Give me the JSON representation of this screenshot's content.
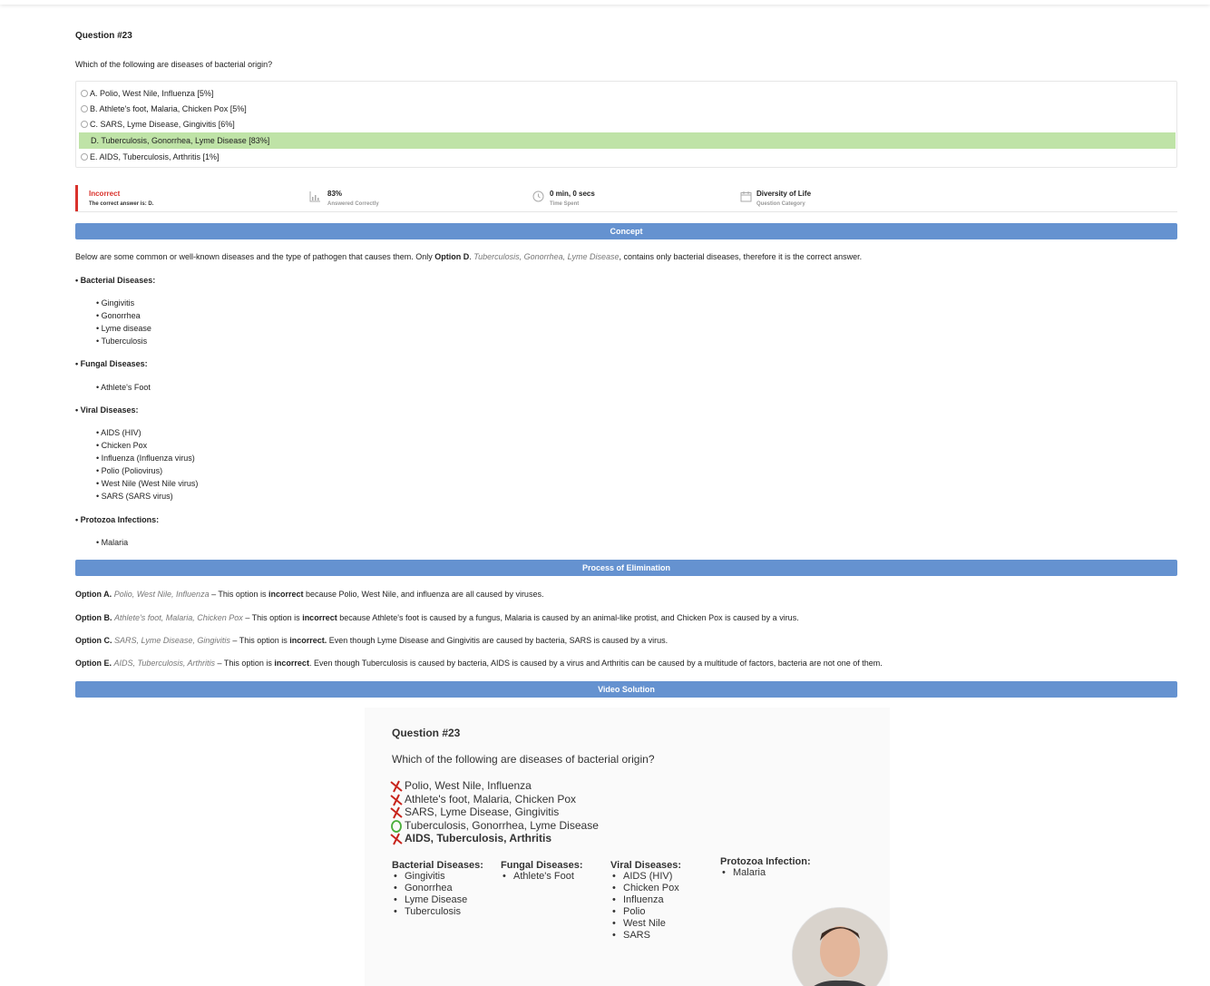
{
  "question": {
    "title": "Question #23",
    "text": "Which of the following are diseases of bacterial origin?",
    "options": [
      {
        "label": "A. Polio, West Nile, Influenza [5%]"
      },
      {
        "label": "B. Athlete's foot, Malaria, Chicken Pox [5%]"
      },
      {
        "label": "C. SARS, Lyme Disease, Gingivitis [6%]"
      },
      {
        "label": "D. Tuberculosis, Gonorrhea, Lyme Disease [83%]"
      },
      {
        "label": "E. AIDS, Tuberculosis, Arthritis [1%]"
      }
    ],
    "correct_color": "#bfe3a7"
  },
  "stats": {
    "result": "Incorrect",
    "result_sub": "The correct answer is: D.",
    "percent": "83%",
    "percent_sub": "Answered Correctly",
    "time": "0 min, 0 secs",
    "time_sub": "Time Spent",
    "category": "Diversity of Life",
    "category_sub": "Question Category",
    "result_color": "#d9322c"
  },
  "concept": {
    "bar": "Concept",
    "intro_before": "Below are some common or well-known diseases and the type of pathogen that causes them. Only ",
    "intro_option": "Option D",
    "intro_dot": ". ",
    "intro_italic": "Tuberculosis, Gonorrhea, Lyme Disease",
    "intro_after": ", contains only bacterial diseases, therefore it is the correct answer.",
    "groups": [
      {
        "heading": "• Bacterial Diseases:",
        "items": [
          "• Gingivitis",
          "• Gonorrhea",
          "• Lyme disease",
          "• Tuberculosis"
        ]
      },
      {
        "heading": "• Fungal Diseases:",
        "items": [
          "• Athlete's Foot"
        ]
      },
      {
        "heading": "• Viral Diseases:",
        "items": [
          "• AIDS (HIV)",
          "• Chicken Pox",
          "• Influenza (Influenza virus)",
          "• Polio (Poliovirus)",
          "• West Nile (West Nile virus)",
          "• SARS (SARS virus)"
        ]
      },
      {
        "heading": "• Protozoa Infections:",
        "items": [
          "• Malaria"
        ]
      }
    ]
  },
  "elimination": {
    "bar": "Process of Elimination",
    "rows": [
      {
        "opt": "Option A.",
        "ital": "Polio, West Nile, Influenza",
        "dash": " – This option is ",
        "bold": "incorrect",
        "rest": " because Polio, West Nile, and influenza are all caused by viruses."
      },
      {
        "opt": "Option B.",
        "ital": "Athlete's foot, Malaria, Chicken Pox",
        "dash": " – This option is ",
        "bold": "incorrect",
        "rest": " because Athlete's foot is caused by a fungus, Malaria is caused by an animal-like protist, and Chicken Pox is caused by a virus."
      },
      {
        "opt": "Option C.",
        "ital": "SARS, Lyme Disease, Gingivitis",
        "dash": " – This option is ",
        "bold": "incorrect.",
        "rest": " Even though Lyme Disease and Gingivitis are caused by bacteria, SARS is caused by a virus."
      },
      {
        "opt": "Option E.",
        "ital": "AIDS, Tuberculosis, Arthritis",
        "dash": " – This option is ",
        "bold": "incorrect",
        "rest": ". Even though Tuberculosis is caused by bacteria, AIDS is caused by a virus and Arthritis can be caused by a multitude of factors, bacteria are not one of them."
      }
    ]
  },
  "video": {
    "bar": "Video Solution",
    "title": "Question #23",
    "question": "Which of the following are diseases of bacterial origin?",
    "options": [
      "Polio, West Nile, Influenza",
      "Athlete's foot, Malaria, Chicken Pox",
      "SARS, Lyme Disease, Gingivitis",
      "Tuberculosis, Gonorrhea, Lyme Disease",
      "AIDS, Tuberculosis, Arthritis"
    ],
    "columns": [
      {
        "heading": "Bacterial Diseases:",
        "items": [
          "Gingivitis",
          "Gonorrhea",
          "Lyme Disease",
          "Tuberculosis"
        ]
      },
      {
        "heading": "Fungal Diseases:",
        "items": [
          "Athlete's Foot"
        ]
      },
      {
        "heading": "Viral Diseases:",
        "items": [
          "AIDS (HIV)",
          "Chicken Pox",
          "Influenza",
          "Polio",
          "West Nile",
          "SARS"
        ]
      },
      {
        "heading": "Protozoa Infection:",
        "items": [
          "Malaria"
        ]
      }
    ]
  }
}
